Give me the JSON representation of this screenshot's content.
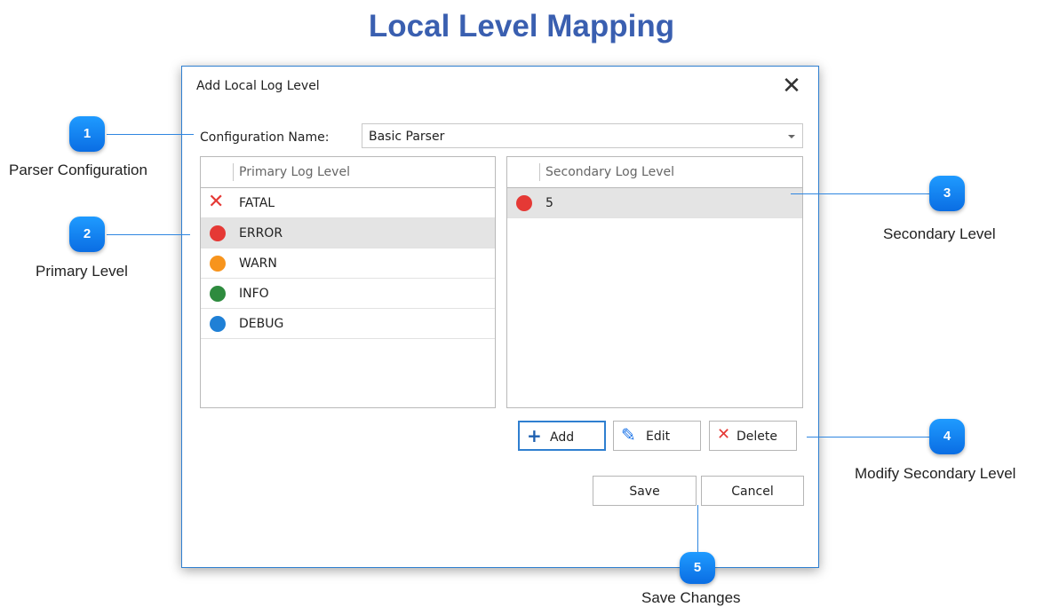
{
  "page": {
    "title": "Local Level Mapping"
  },
  "dialog": {
    "title": "Add Local Log Level",
    "close_icon": "close-icon",
    "config": {
      "label": "Configuration Name:",
      "value": "Basic Parser"
    },
    "primary": {
      "header": "Primary Log Level",
      "rows": [
        {
          "label": "FATAL",
          "icon": "x-icon",
          "color": "#e53935"
        },
        {
          "label": "ERROR",
          "icon": "dot-icon",
          "color": "#e53935",
          "selected": true
        },
        {
          "label": "WARN",
          "icon": "dot-icon",
          "color": "#f7941d"
        },
        {
          "label": "INFO",
          "icon": "dot-icon",
          "color": "#2e8b3e"
        },
        {
          "label": "DEBUG",
          "icon": "dot-icon",
          "color": "#1f80d6"
        }
      ]
    },
    "secondary": {
      "header": "Secondary Log Level",
      "rows": [
        {
          "label": "5",
          "icon": "dot-icon",
          "color": "#e53935",
          "selected": true
        }
      ]
    },
    "buttons": {
      "add": "Add",
      "edit": "Edit",
      "delete": "Delete",
      "save": "Save",
      "cancel": "Cancel"
    }
  },
  "callouts": [
    {
      "number": "1",
      "label": "Parser Configuration"
    },
    {
      "number": "2",
      "label": "Primary Level"
    },
    {
      "number": "3",
      "label": "Secondary Level"
    },
    {
      "number": "4",
      "label": "Modify Secondary Level"
    },
    {
      "number": "5",
      "label": "Save Changes"
    }
  ],
  "colors": {
    "accent": "#2f7fd0",
    "title": "#3a5fb0",
    "callout": "#1a84f0"
  }
}
